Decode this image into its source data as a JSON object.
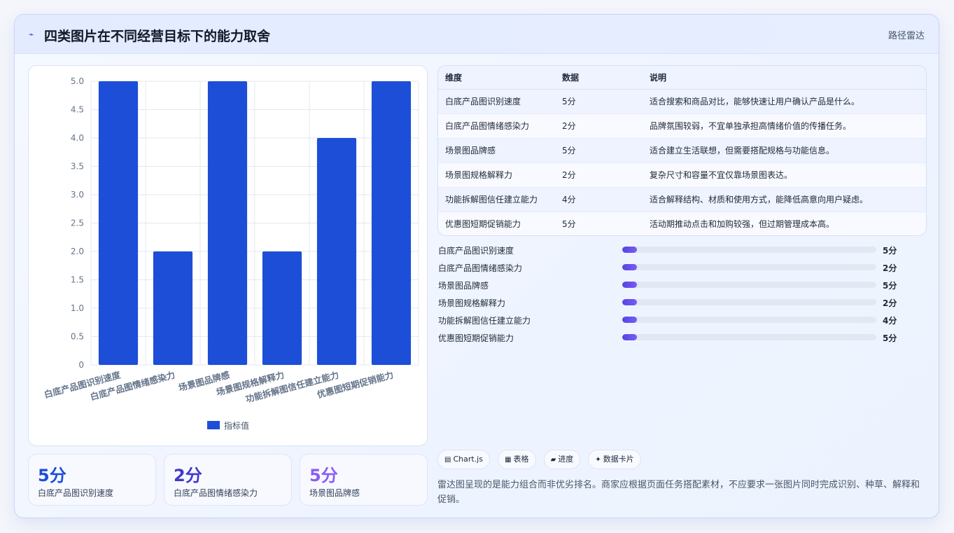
{
  "header": {
    "icon": "pulse-icon",
    "icon_glyph": "⌁",
    "title": "四类图片在不同经营目标下的能力取舍",
    "mode": "路径雷达"
  },
  "chart_data": {
    "type": "bar",
    "categories": [
      "白底产品图识别速度",
      "白底产品图情绪感染力",
      "场景图品牌感",
      "场景图规格解释力",
      "功能拆解图信任建立能力",
      "优惠图短期促销能力"
    ],
    "series": [
      {
        "name": "指标值",
        "values": [
          5,
          2,
          5,
          2,
          4,
          5
        ],
        "color": "#1d4ed8"
      }
    ],
    "ylim": [
      0,
      5
    ],
    "yticks": [
      "0",
      "0.5",
      "1.0",
      "1.5",
      "2.0",
      "2.5",
      "3.0",
      "3.5",
      "4.0",
      "4.5",
      "5.0"
    ],
    "grid": true,
    "legend": "bottom"
  },
  "stats": [
    {
      "value": "5分",
      "label": "白底产品图识别速度",
      "color": "#1d4ed8"
    },
    {
      "value": "2分",
      "label": "白底产品图情绪感染力",
      "color": "#4338ca"
    },
    {
      "value": "5分",
      "label": "场景图品牌感",
      "color": "#8b5cf6"
    }
  ],
  "table": {
    "headers": [
      "维度",
      "数据",
      "说明"
    ],
    "rows": [
      [
        "白底产品图识别速度",
        "5分",
        "适合搜索和商品对比，能够快速让用户确认产品是什么。"
      ],
      [
        "白底产品图情绪感染力",
        "2分",
        "品牌氛围较弱，不宜单独承担高情绪价值的传播任务。"
      ],
      [
        "场景图品牌感",
        "5分",
        "适合建立生活联想，但需要搭配规格与功能信息。"
      ],
      [
        "场景图规格解释力",
        "2分",
        "复杂尺寸和容量不宜仅靠场景图表达。"
      ],
      [
        "功能拆解图信任建立能力",
        "4分",
        "适合解释结构、材质和使用方式，能降低高意向用户疑虑。"
      ],
      [
        "优惠图短期促销能力",
        "5分",
        "活动期推动点击和加购较强，但过期管理成本高。"
      ]
    ]
  },
  "progress": [
    {
      "label": "白底产品图识别速度",
      "value": "5分",
      "fill_fraction": 0.057
    },
    {
      "label": "白底产品图情绪感染力",
      "value": "2分",
      "fill_fraction": 0.057
    },
    {
      "label": "场景图品牌感",
      "value": "5分",
      "fill_fraction": 0.057
    },
    {
      "label": "场景图规格解释力",
      "value": "2分",
      "fill_fraction": 0.057
    },
    {
      "label": "功能拆解图信任建立能力",
      "value": "4分",
      "fill_fraction": 0.057
    },
    {
      "label": "优惠图短期促销能力",
      "value": "5分",
      "fill_fraction": 0.057
    }
  ],
  "tags": [
    {
      "icon": "chart-icon",
      "glyph": "▤",
      "label": "Chart.js"
    },
    {
      "icon": "table-icon",
      "glyph": "▦",
      "label": "表格"
    },
    {
      "icon": "progress-icon",
      "glyph": "▰",
      "label": "进度"
    },
    {
      "icon": "sparkle-icon",
      "glyph": "✦",
      "label": "数据卡片"
    }
  ],
  "note": "雷达图呈现的是能力组合而非优劣排名。商家应根据页面任务搭配素材，不应要求一张图片同时完成识别、种草、解释和促销。"
}
